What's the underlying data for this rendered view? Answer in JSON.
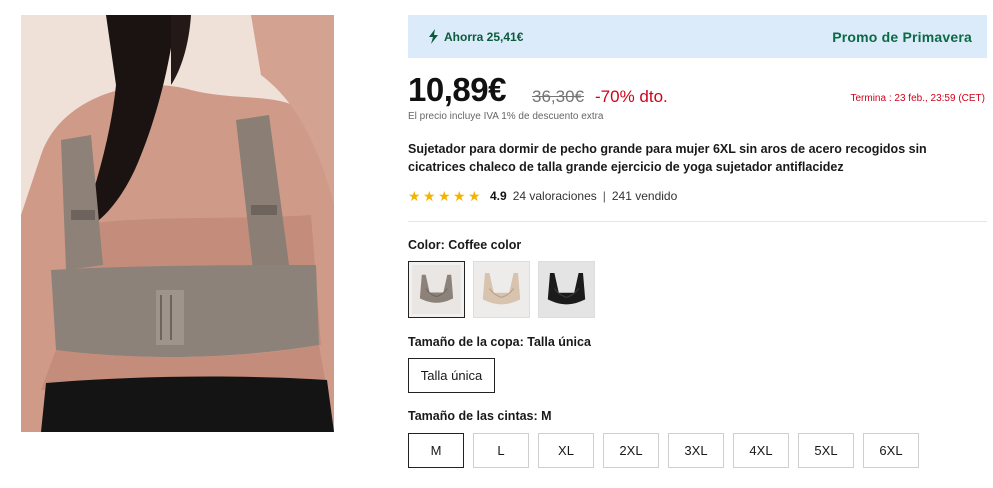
{
  "promo": {
    "savings": "Ahorra 25,41€",
    "campaign": "Promo de Primavera",
    "accent": "#0a6a46",
    "background": "#dcebf9"
  },
  "price": {
    "current": "10,89€",
    "original": "36,30€",
    "discount": "-70% dto.",
    "deadline": "Termina :  23 feb., 23:59 (CET)",
    "tax_note": "El precio incluye IVA 1% de descuento extra",
    "discount_color": "#d0021b"
  },
  "product": {
    "title": "Sujetador para dormir de pecho grande para mujer 6XL sin aros de acero recogidos sin cicatrices chaleco de talla grande ejercicio de yoga sujetador antiflacidez"
  },
  "rating": {
    "score": "4.9",
    "stars": 5,
    "reviews": "24 valoraciones",
    "separator": "|",
    "sold": "241 vendido",
    "star_color": "#f5b301"
  },
  "color": {
    "label": "Color: Coffee color",
    "options": [
      {
        "name": "Coffee color",
        "hex": "#8c827a",
        "selected": true
      },
      {
        "name": "Beige",
        "hex": "#d8c3ae",
        "selected": false
      },
      {
        "name": "Black",
        "hex": "#1b1b1b",
        "selected": false
      }
    ]
  },
  "cup": {
    "label": "Tamaño de la copa: Talla única",
    "options": [
      "Talla única"
    ],
    "selected": "Talla única"
  },
  "band": {
    "label": "Tamaño de las cintas: M",
    "options": [
      "M",
      "L",
      "XL",
      "2XL",
      "3XL",
      "4XL",
      "5XL",
      "6XL"
    ],
    "selected": "M"
  }
}
